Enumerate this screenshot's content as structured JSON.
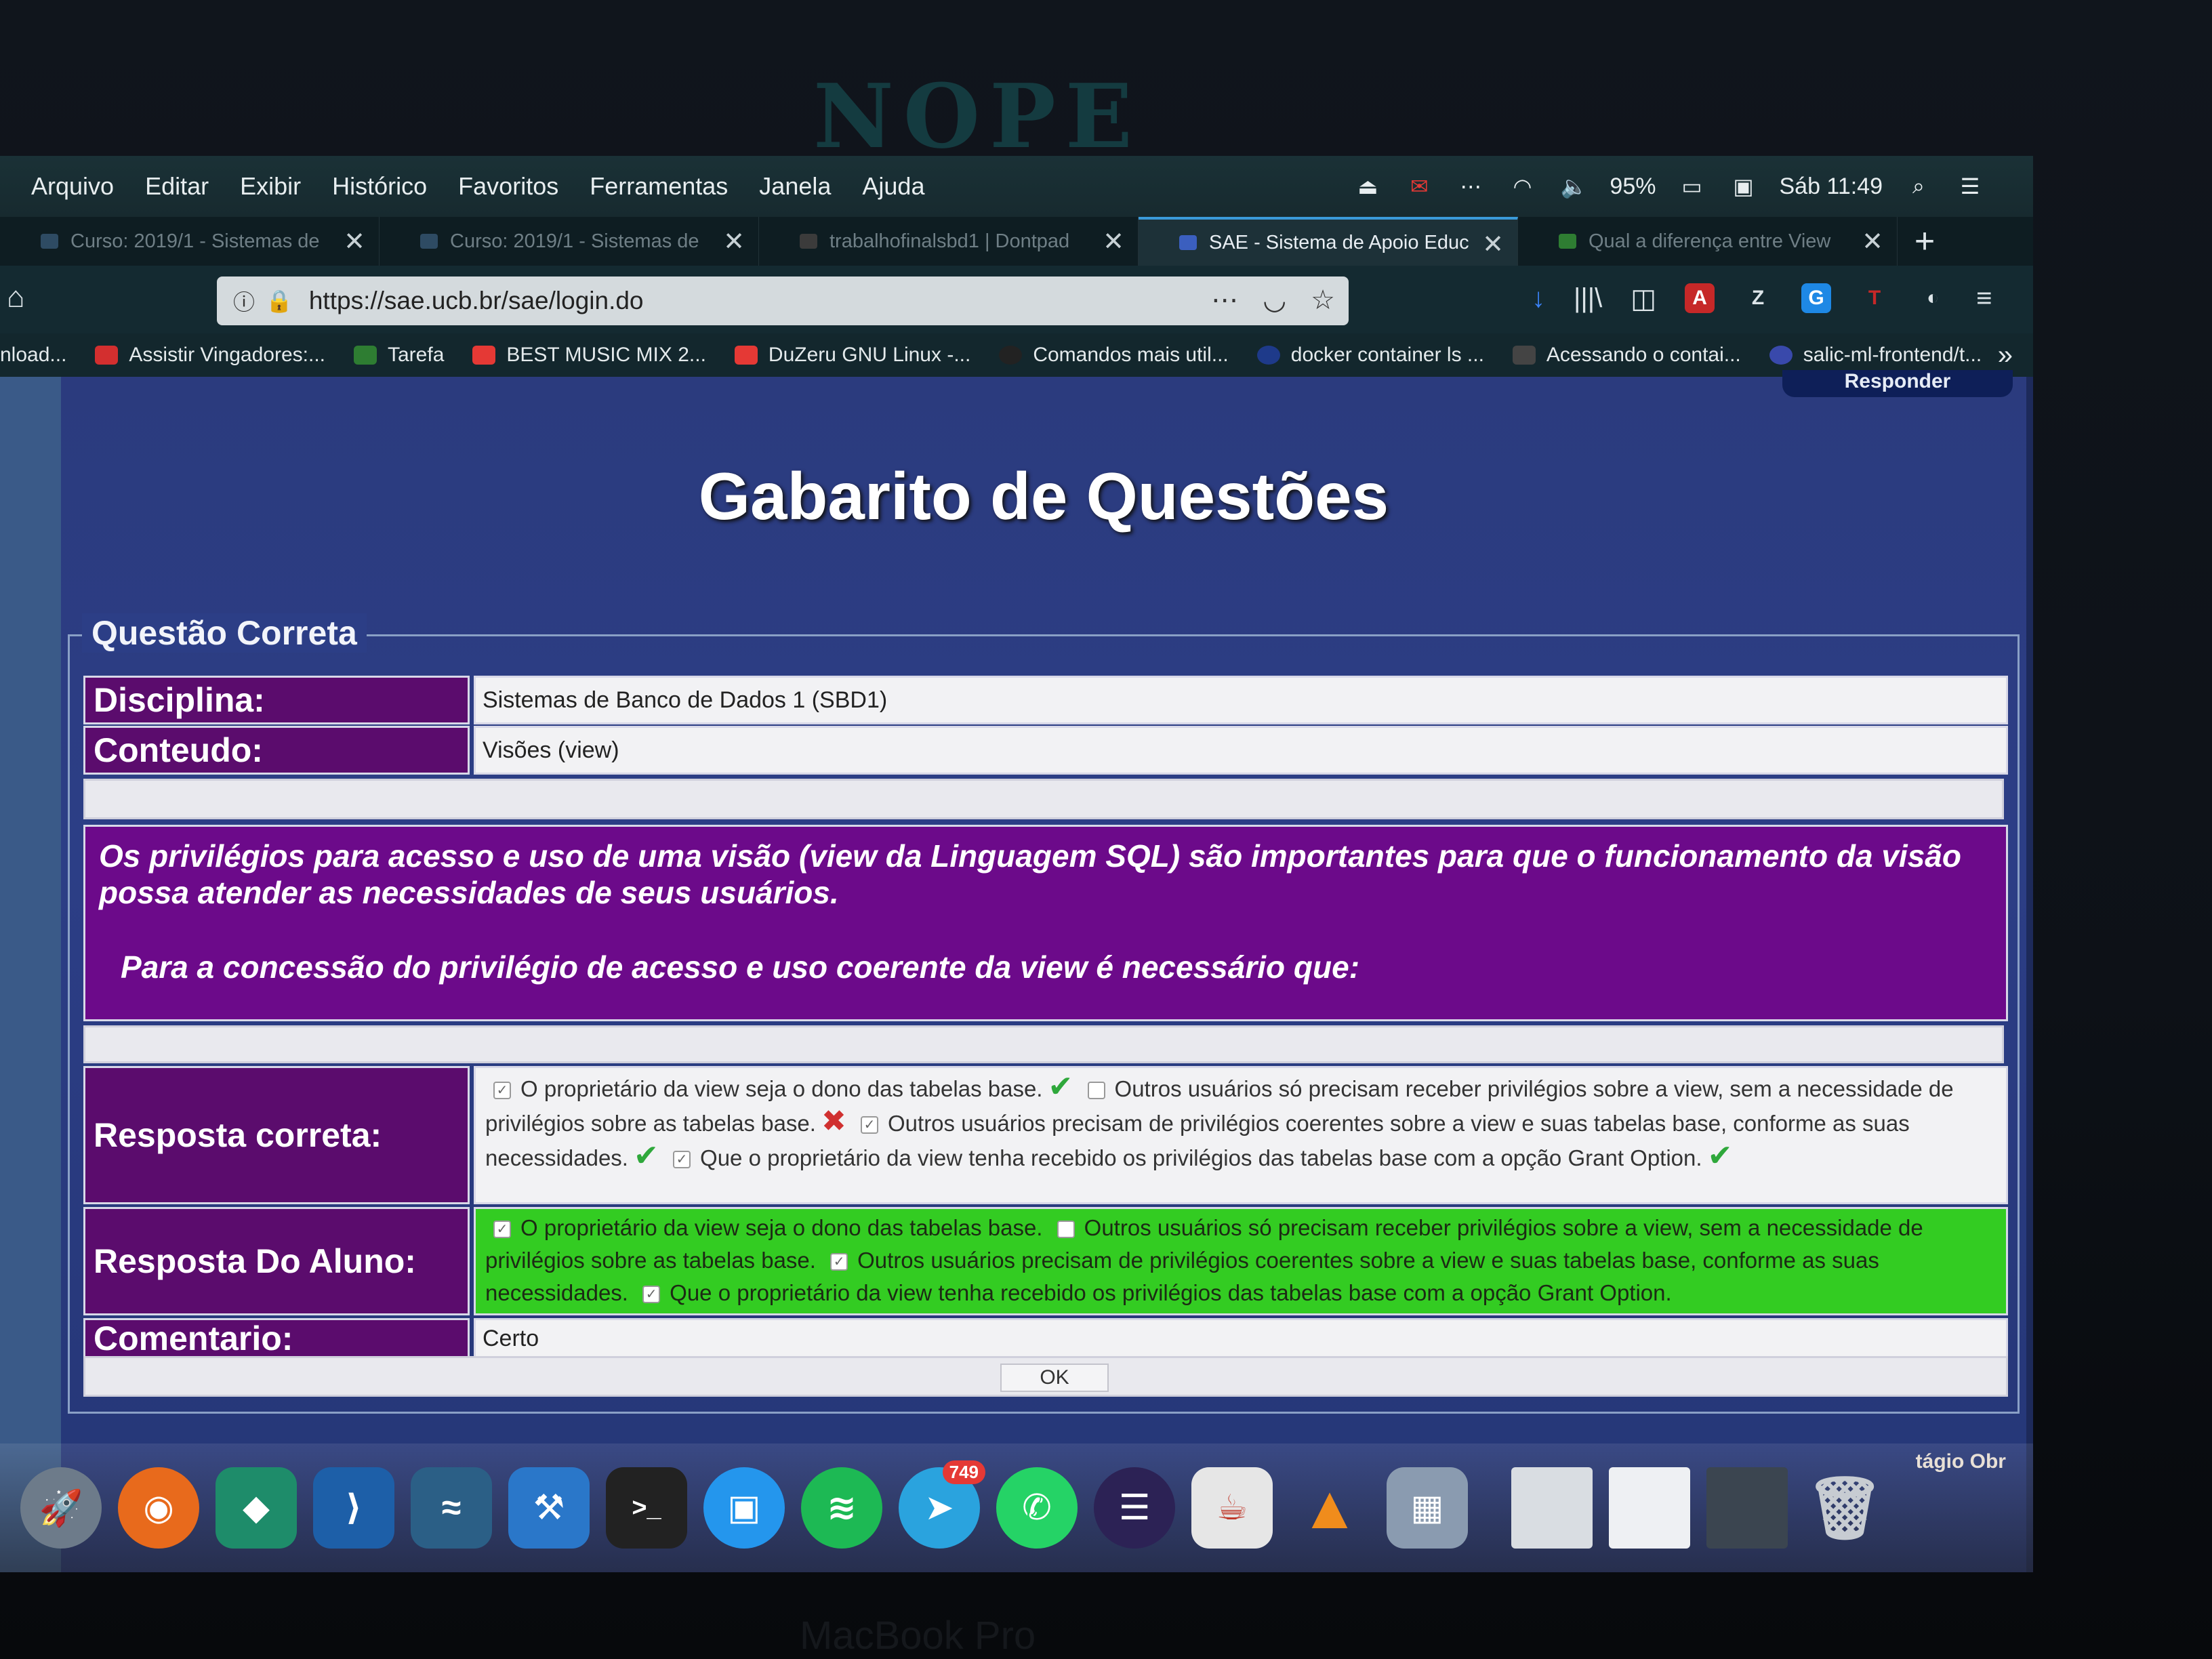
{
  "bezel": {
    "logo": "NOPE",
    "bottom_label": "MacBook Pro"
  },
  "menubar": {
    "items": [
      "Arquivo",
      "Editar",
      "Exibir",
      "Histórico",
      "Favoritos",
      "Ferramentas",
      "Janela",
      "Ajuda"
    ],
    "battery": "95%",
    "clock": "Sáb 11:49"
  },
  "tabs": [
    {
      "label": "Curso: 2019/1 - Sistemas de",
      "active": false
    },
    {
      "label": "Curso: 2019/1 - Sistemas de",
      "active": false
    },
    {
      "label": "trabalhofinalsbd1 | Dontpad",
      "active": false
    },
    {
      "label": "SAE - Sistema de Apoio Educ",
      "active": true
    },
    {
      "label": "Qual a diferença entre View",
      "active": false
    }
  ],
  "url": "https://sae.ucb.br/sae/login.do",
  "bookmarks": [
    {
      "label": "nload...",
      "color": "transparent"
    },
    {
      "label": "Assistir Vingadores:...",
      "color": "#d32f2f"
    },
    {
      "label": "Tarefa",
      "color": "#2e7d32"
    },
    {
      "label": "BEST MUSIC MIX 2...",
      "color": "#e53935"
    },
    {
      "label": "DuZeru GNU Linux -...",
      "color": "#e53935"
    },
    {
      "label": "Comandos mais util...",
      "color": "#222222"
    },
    {
      "label": "docker container ls ...",
      "color": "#1e3a8a"
    },
    {
      "label": "Acessando o contai...",
      "color": "#444444"
    },
    {
      "label": "salic-ml-frontend/t...",
      "color": "#3949ab"
    }
  ],
  "page": {
    "responder_label": "Responder",
    "title": "Gabarito de Questões",
    "legend": "Questão Correta",
    "disciplina_label": "Disciplina:",
    "disciplina_value": "Sistemas de Banco de Dados 1 (SBD1)",
    "conteudo_label": "Conteudo:",
    "conteudo_value": "Visões (view)",
    "question_line1": "Os privilégios para acesso e uso de uma visão (view da Linguagem SQL) são importantes para que o funcionamento da visão possa atender as necessidades de seus usuários.",
    "question_line2": "Para a concessão do privilégio de acesso e uso coerente da view é necessário que:",
    "resposta_correta_label": "Resposta correta:",
    "resposta_aluno_label": "Resposta Do Aluno:",
    "options": [
      "O proprietário da view seja o dono das tabelas base.",
      "Outros usuários só precisam receber privilégios sobre a view, sem a necessidade de privilégios sobre as tabelas base.",
      "Outros usuários precisam de privilégios coerentes sobre a view e suas tabelas base, conforme as suas necessidades.",
      "Que o proprietário da view tenha recebido os privilégios das tabelas base com a opção Grant Option."
    ],
    "comentario_label": "Comentario:",
    "comentario_value": "Certo",
    "ok_label": "OK"
  },
  "dock": {
    "apps": [
      {
        "name": "launchpad-icon",
        "color": "#6d7b8a",
        "glyph": "🚀"
      },
      {
        "name": "firefox-icon",
        "color": "#e86a1c",
        "glyph": "◉"
      },
      {
        "name": "editor-icon",
        "color": "#1e8c6a",
        "glyph": "◆"
      },
      {
        "name": "vscode-icon",
        "color": "#1d5fa8",
        "glyph": "⟩"
      },
      {
        "name": "mysql-workbench-icon",
        "color": "#2b5f86",
        "glyph": "≈"
      },
      {
        "name": "xcode-icon",
        "color": "#2a77c9",
        "glyph": "⚒"
      },
      {
        "name": "terminal-icon",
        "color": "#222222",
        "glyph": ">_"
      },
      {
        "name": "docker-icon",
        "color": "#2496ed",
        "glyph": "▣"
      },
      {
        "name": "spotify-icon",
        "color": "#1db954",
        "glyph": "≋"
      },
      {
        "name": "telegram-icon",
        "color": "#2aa3de",
        "glyph": "➤",
        "badge": "749"
      },
      {
        "name": "whatsapp-icon",
        "color": "#25d366",
        "glyph": "✆"
      },
      {
        "name": "eclipse-icon",
        "color": "#2c2255",
        "glyph": "☰"
      },
      {
        "name": "java-icon",
        "color": "#e6e6e6",
        "glyph": "☕"
      },
      {
        "name": "vlc-icon",
        "color": "#f08c1c",
        "glyph": "▲"
      },
      {
        "name": "preview-icon",
        "color": "#8a9bb0",
        "glyph": "▦"
      },
      {
        "name": "window-thumb-1-icon",
        "color": "#d9dde2",
        "glyph": ""
      },
      {
        "name": "window-thumb-2-icon",
        "color": "#eef0f3",
        "glyph": ""
      },
      {
        "name": "window-thumb-3-icon",
        "color": "#3b4550",
        "glyph": ""
      },
      {
        "name": "trash-icon",
        "color": "#c7ccd2",
        "glyph": "🗑"
      }
    ],
    "label": "tágio Obr"
  },
  "colors": {
    "label_bg": "#5b0c6d",
    "question_bg": "#6c0a8a",
    "student_answer_bg": "#33cc22",
    "correct_mark": "#2fa83b",
    "wrong_mark": "#d03030"
  }
}
